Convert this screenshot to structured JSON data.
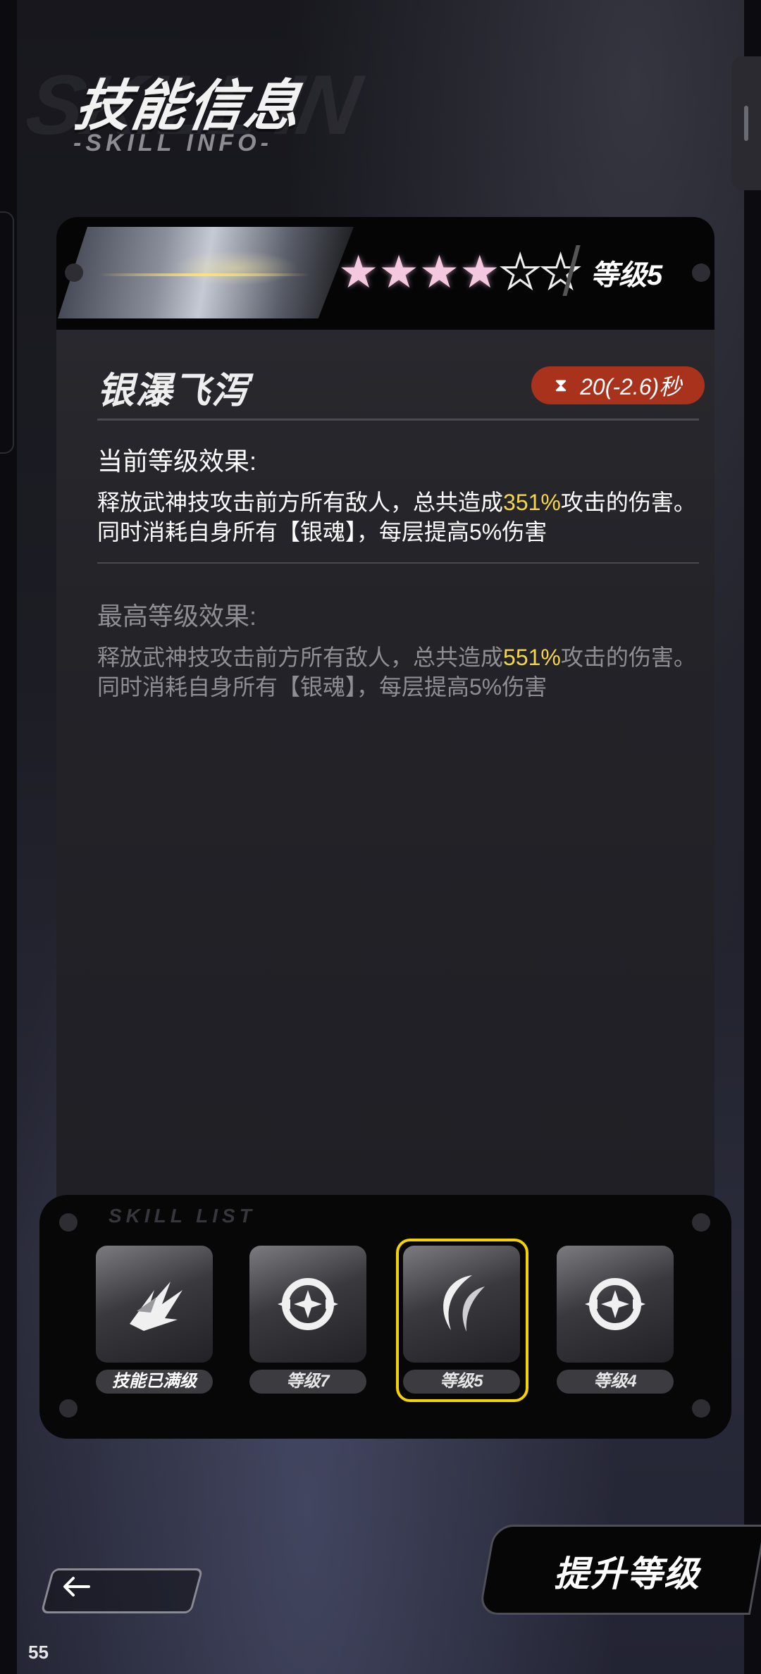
{
  "header": {
    "title": "技能信息",
    "subtitle": "-SKILL INFO-"
  },
  "skill_card": {
    "stars_filled": 4,
    "stars_total": 6,
    "level_label": "等级5",
    "skill_name": "银瀑飞泻",
    "cooldown": "20(-2.6)秒",
    "current_effect_title": "当前等级效果:",
    "current_effect_part1": "释放武神技攻击前方所有敌人，总共造成",
    "current_effect_highlight": "351%",
    "current_effect_part2": "攻击的伤害。同时消耗自身所有【银魂】，每层提高5%伤害",
    "max_effect_title": "最高等级效果:",
    "max_effect_part1": "释放武神技攻击前方所有敌人，总共造成",
    "max_effect_highlight": "551%",
    "max_effect_part2": "攻击的伤害。同时消耗自身所有【银魂】，每层提高5%伤害"
  },
  "skill_list": {
    "panel_tag": "SKILL LIST",
    "items": [
      {
        "label": "技能已满级",
        "icon": "claw-icon",
        "selected": false
      },
      {
        "label": "等级7",
        "icon": "crosshair-icon",
        "selected": false
      },
      {
        "label": "等级5",
        "icon": "crescent-icon",
        "selected": true
      },
      {
        "label": "等级4",
        "icon": "crosshair-icon",
        "selected": false
      }
    ]
  },
  "actions": {
    "upgrade_label": "提升等级",
    "back_icon": "arrow-left-icon"
  },
  "page_number": "55",
  "colors": {
    "highlight": "#f6d64a",
    "cooldown_badge": "#a8321c",
    "selected_frame": "#f6d200"
  }
}
